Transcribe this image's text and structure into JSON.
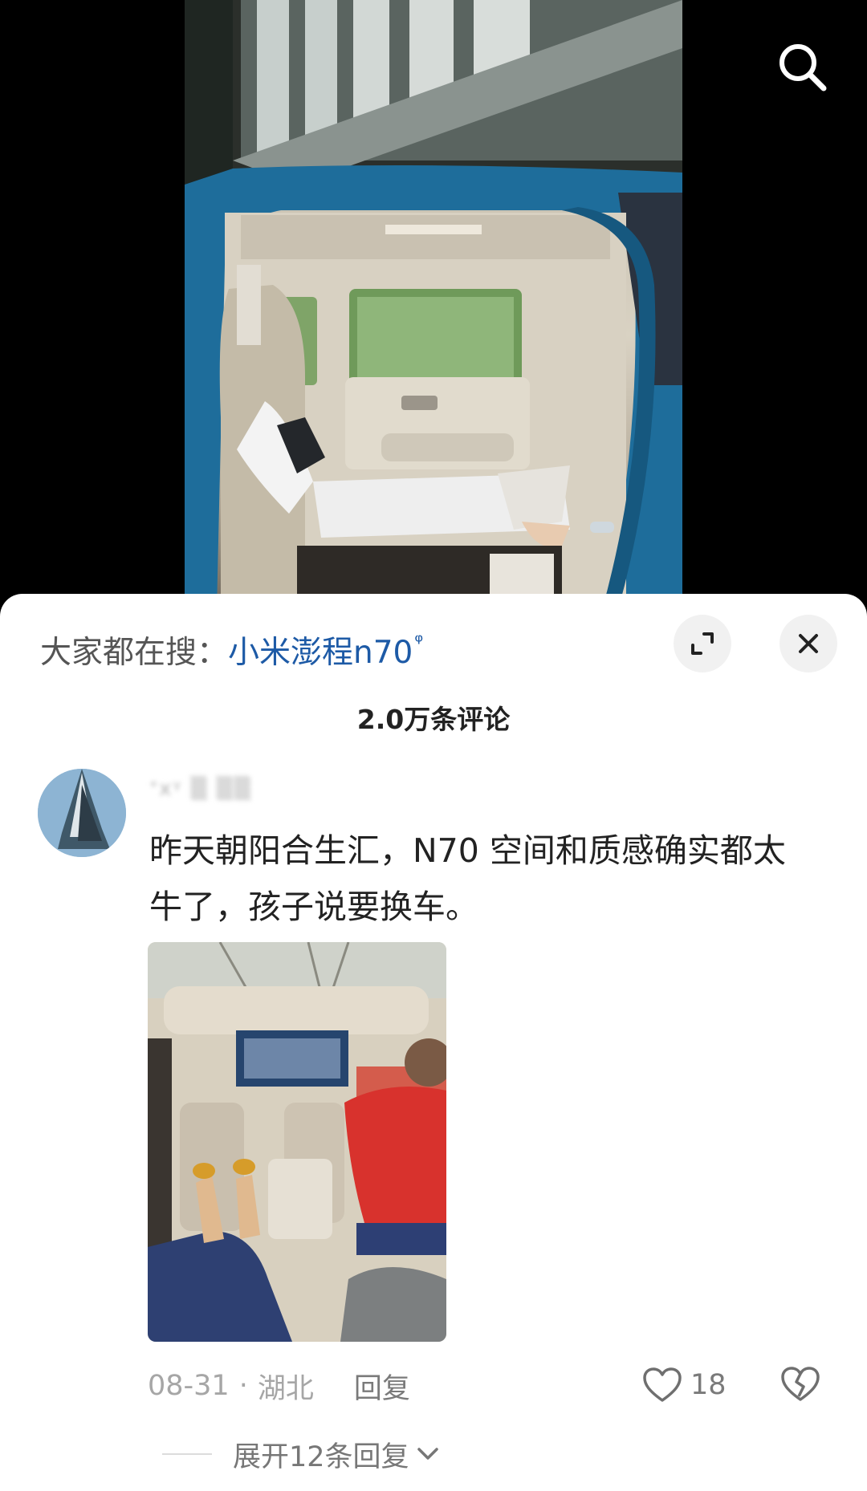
{
  "icons": {
    "search": "search-icon",
    "expand": "expand-icon",
    "close": "close-icon",
    "like": "heart-outline-icon",
    "dislike": "broken-heart-icon",
    "chevron": "chevron-down-icon"
  },
  "hot_search": {
    "label": "大家都在搜：",
    "term": "小米澎程n70",
    "icon": "ᵠ"
  },
  "comments_header": {
    "count_label": "2.0万条评论"
  },
  "comment": {
    "username": "ᐩxᵞ ▒ ▒▒",
    "text": "昨天朝阳合生汇，N70 空间和质感确实都太牛了，孩子说要换车。",
    "date": "08-31",
    "separator": "·",
    "location": "湖北",
    "reply_label": "回复",
    "like_count": "18",
    "expand_replies_label": "展开12条回复"
  },
  "colors": {
    "accent_link": "#1d5aa6",
    "sheet_bg": "#ffffff",
    "muted_text": "#a6a6a6"
  }
}
